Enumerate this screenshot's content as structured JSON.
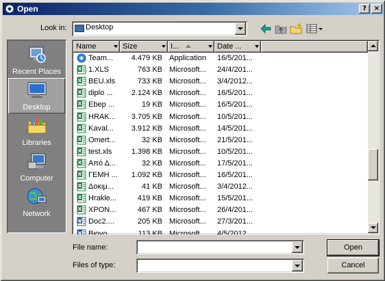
{
  "window": {
    "title": "Open",
    "help_label": "?",
    "close_label": "×"
  },
  "look_in": {
    "label": "Look in:",
    "value": "Desktop"
  },
  "toolbar": {
    "icons": [
      "back-icon",
      "up-folder-icon",
      "new-folder-icon",
      "view-menu-icon"
    ]
  },
  "places": [
    {
      "label": "Recent Places",
      "icon": "recent-places-icon"
    },
    {
      "label": "Desktop",
      "icon": "desktop-icon",
      "selected": true
    },
    {
      "label": "Libraries",
      "icon": "libraries-icon"
    },
    {
      "label": "Computer",
      "icon": "computer-icon"
    },
    {
      "label": "Network",
      "icon": "network-icon"
    }
  ],
  "columns": {
    "name": "Name",
    "size": "Size",
    "type": "I...",
    "date": "Date ..."
  },
  "files": [
    {
      "name": "Team...",
      "size": "4.479 KB",
      "type": "Application",
      "date": "16/5/201...",
      "icon": "application"
    },
    {
      "name": "1.XLS",
      "size": "763 KB",
      "type": "Microsoft...",
      "date": "24/4/201...",
      "icon": "excel"
    },
    {
      "name": "BEU.xls",
      "size": "733 KB",
      "type": "Microsoft...",
      "date": "3/4/2012...",
      "icon": "excel"
    },
    {
      "name": "diplo ...",
      "size": "2.124 KB",
      "type": "Microsoft...",
      "date": "16/5/201...",
      "icon": "excel"
    },
    {
      "name": "Εbep ...",
      "size": "19 KB",
      "type": "Microsoft...",
      "date": "16/5/201...",
      "icon": "excel"
    },
    {
      "name": "HRAK...",
      "size": "3.705 KB",
      "type": "Microsoft...",
      "date": "10/5/201...",
      "icon": "excel"
    },
    {
      "name": "Kaval...",
      "size": "3.912 KB",
      "type": "Microsoft...",
      "date": "14/5/201...",
      "icon": "excel"
    },
    {
      "name": "Omert...",
      "size": "32 KB",
      "type": "Microsoft...",
      "date": "21/5/201...",
      "icon": "excel"
    },
    {
      "name": "test.xls",
      "size": "1.398 KB",
      "type": "Microsoft...",
      "date": "10/5/201...",
      "icon": "excel"
    },
    {
      "name": "Από Δ...",
      "size": "32 KB",
      "type": "Microsoft...",
      "date": "17/5/201...",
      "icon": "excel"
    },
    {
      "name": "ΓΕΜΗ ...",
      "size": "1.092 KB",
      "type": "Microsoft...",
      "date": "16/5/201...",
      "icon": "excel"
    },
    {
      "name": "Δοκιμ...",
      "size": "41 KB",
      "type": "Microsoft...",
      "date": "3/4/2012...",
      "icon": "excel"
    },
    {
      "name": "Hrakle...",
      "size": "419 KB",
      "type": "Microsoft...",
      "date": "15/5/201...",
      "icon": "excel"
    },
    {
      "name": "ΧΡΟΝ...",
      "size": "467 KB",
      "type": "Microsoft...",
      "date": "26/4/201...",
      "icon": "excel"
    },
    {
      "name": "Doc2....",
      "size": "205 KB",
      "type": "Microsoft...",
      "date": "27/3/201...",
      "icon": "word"
    },
    {
      "name": "Βιογρ...",
      "size": "113 KB",
      "type": "Microsoft...",
      "date": "4/5/2012...",
      "icon": "word"
    }
  ],
  "file_name": {
    "label": "File name:",
    "value": ""
  },
  "files_of_type": {
    "label": "Files of type:",
    "value": ""
  },
  "buttons": {
    "open": "Open",
    "cancel": "Cancel"
  },
  "colors": {
    "title_start": "#0a246a",
    "title_end": "#a6caf0",
    "face": "#d4d0c8",
    "places_bg": "#808080",
    "excel_green": "#1e7b34",
    "word_blue": "#2b5797"
  }
}
